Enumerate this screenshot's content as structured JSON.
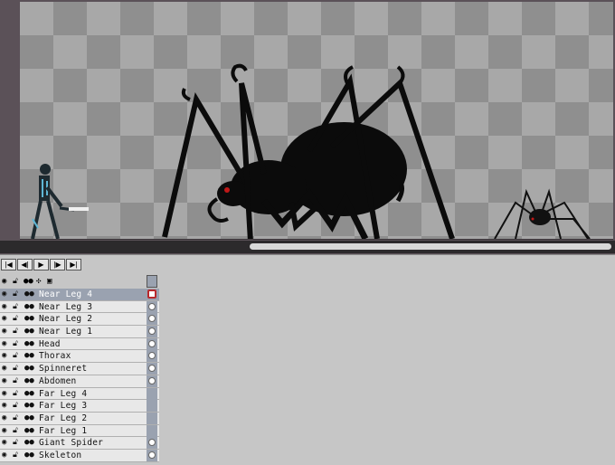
{
  "canvas": {
    "checker_light": "#a8a8a8",
    "checker_dark": "#8f8f8f",
    "figures": [
      {
        "id": "skeleton",
        "color": "#1e2a30",
        "accent": "#5fb7d6"
      },
      {
        "id": "giant-spider",
        "color": "#0b0b0b",
        "eye": "#c01818"
      },
      {
        "id": "small-spider",
        "color": "#111111",
        "eye": "#c01818"
      }
    ]
  },
  "transport": {
    "buttons": [
      {
        "name": "first-frame-button",
        "glyph": "|◀"
      },
      {
        "name": "prev-frame-button",
        "glyph": "◀|"
      },
      {
        "name": "play-button",
        "glyph": "▶"
      },
      {
        "name": "next-frame-button",
        "glyph": "|▶"
      },
      {
        "name": "last-frame-button",
        "glyph": "▶|"
      }
    ]
  },
  "layer_header_icons": [
    "eye-icon",
    "lock-icon",
    "link-icon",
    "blend-icon",
    "square-icon"
  ],
  "layers": [
    {
      "label": "Near Leg 4",
      "selected": true,
      "cel": "key"
    },
    {
      "label": "Near Leg 3",
      "selected": false,
      "cel": "key"
    },
    {
      "label": "Near Leg 2",
      "selected": false,
      "cel": "key"
    },
    {
      "label": "Near Leg 1",
      "selected": false,
      "cel": "key"
    },
    {
      "label": "Head",
      "selected": false,
      "cel": "key"
    },
    {
      "label": "Thorax",
      "selected": false,
      "cel": "key"
    },
    {
      "label": "Spinneret",
      "selected": false,
      "cel": "key"
    },
    {
      "label": "Abdomen",
      "selected": false,
      "cel": "key"
    },
    {
      "label": "Far Leg 4",
      "selected": false,
      "cel": "empty"
    },
    {
      "label": "Far Leg 3",
      "selected": false,
      "cel": "empty"
    },
    {
      "label": "Far Leg 2",
      "selected": false,
      "cel": "empty"
    },
    {
      "label": "Far Leg 1",
      "selected": false,
      "cel": "empty"
    },
    {
      "label": "Giant Spider",
      "selected": false,
      "cel": "key"
    },
    {
      "label": "Skeleton",
      "selected": false,
      "cel": "key"
    }
  ]
}
